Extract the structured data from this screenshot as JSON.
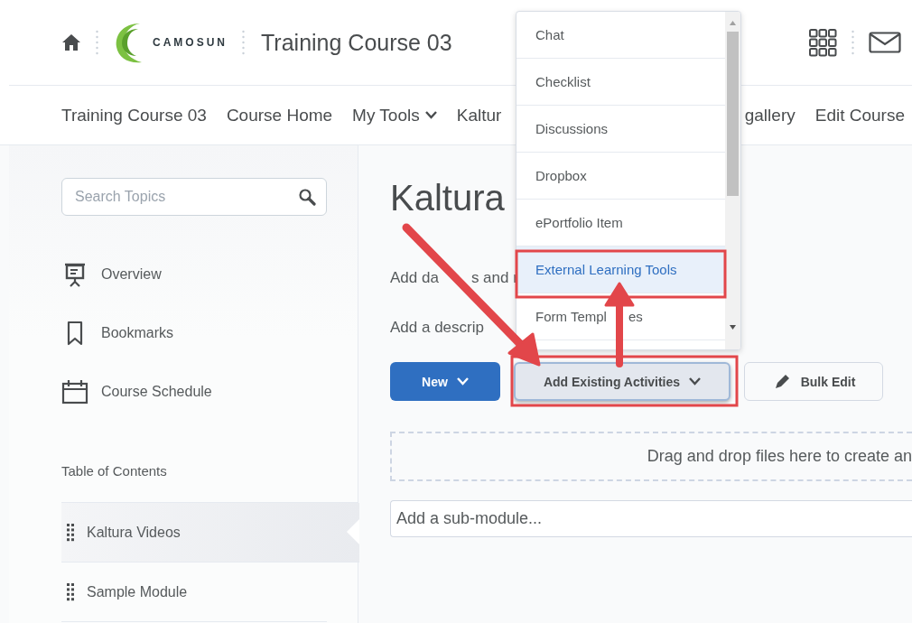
{
  "header": {
    "logo_text": "CAMOSUN",
    "course_title": "Training Course 03"
  },
  "nav": {
    "items": [
      {
        "label": "Training Course 03",
        "menu": false
      },
      {
        "label": "Course Home",
        "menu": false
      },
      {
        "label": "My Tools",
        "menu": true
      },
      {
        "label": "Kaltur",
        "menu": false
      },
      {
        "label": "gallery",
        "menu": false
      },
      {
        "label": "Edit Course",
        "menu": false
      }
    ]
  },
  "sidebar": {
    "search": {
      "placeholder": "Search Topics"
    },
    "links": [
      {
        "label": "Overview",
        "kind": "overview"
      },
      {
        "label": "Bookmarks",
        "kind": "bookmarks"
      },
      {
        "label": "Course Schedule",
        "kind": "schedule"
      }
    ],
    "toc_heading": "Table of Contents",
    "toc_items": [
      {
        "label": "Kaltura Videos",
        "selected": true
      },
      {
        "label": "Sample Module",
        "selected": false
      }
    ]
  },
  "content": {
    "title": "Kaltura",
    "dates_prompt": [
      "Add da",
      "s and r"
    ],
    "description_prompt": [
      "Add a descrip"
    ],
    "buttons": [
      {
        "label": "New",
        "kind": "primary",
        "expanded": false
      },
      {
        "label": "Add Existing Activities",
        "kind": "menu",
        "expanded": true
      },
      {
        "label": "Bulk Edit",
        "kind": "edit",
        "expanded": false
      }
    ],
    "dropzone": "Drag and drop files here to create an",
    "submodule": {
      "placeholder": "Add a sub-module..."
    }
  },
  "dropdown": {
    "items": [
      {
        "label": [
          "Chat"
        ],
        "selected": false
      },
      {
        "label": [
          "Checklist"
        ],
        "selected": false
      },
      {
        "label": [
          "Discussions"
        ],
        "selected": false
      },
      {
        "label": [
          "Dropbox"
        ],
        "selected": false
      },
      {
        "label": [
          "ePortfolio Item"
        ],
        "selected": false
      },
      {
        "label": [
          "External Learning Tools"
        ],
        "selected": true
      },
      {
        "label": [
          "Form Templ",
          "es"
        ],
        "selected": false
      }
    ]
  }
}
